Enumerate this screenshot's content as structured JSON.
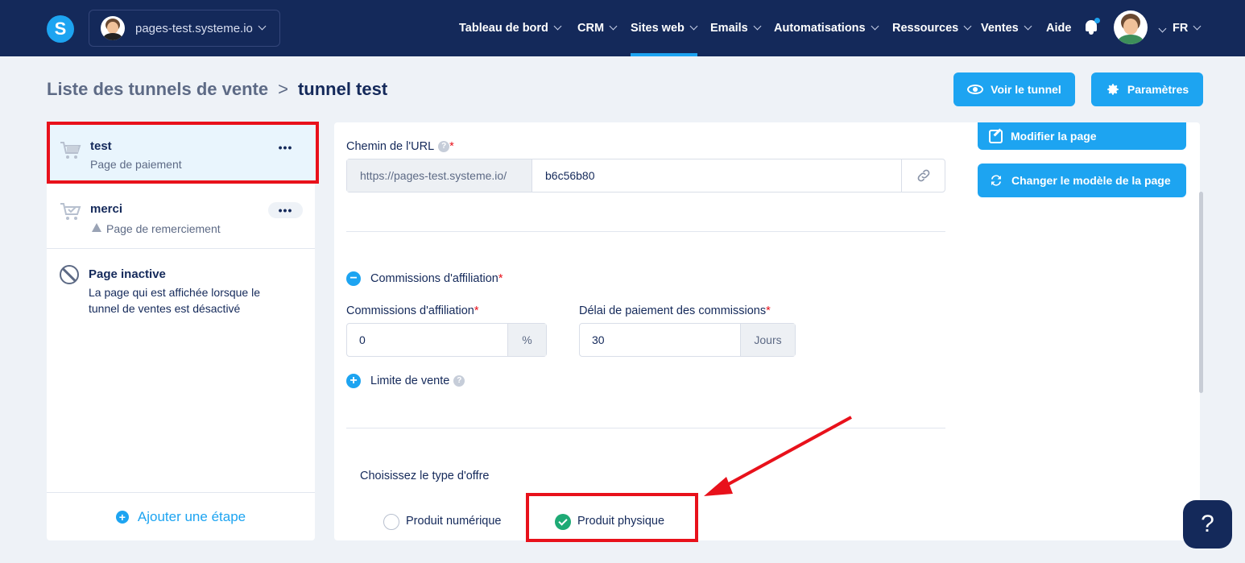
{
  "topbar": {
    "logo": "S",
    "site": "pages-test.systeme.io",
    "nav": [
      {
        "label": "Tableau de bord",
        "has_dropdown": true
      },
      {
        "label": "CRM",
        "has_dropdown": true
      },
      {
        "label": "Sites web",
        "has_dropdown": true,
        "active": true
      },
      {
        "label": "Emails",
        "has_dropdown": true
      },
      {
        "label": "Automatisations",
        "has_dropdown": true
      },
      {
        "label": "Ressources",
        "has_dropdown": true
      },
      {
        "label": "Ventes",
        "has_dropdown": true
      },
      {
        "label": "Aide",
        "has_dropdown": false
      }
    ],
    "lang": "FR"
  },
  "breadcrumb": {
    "parent": "Liste des tunnels de vente",
    "separator": ">",
    "current": "tunnel test"
  },
  "header_buttons": {
    "view": "Voir le tunnel",
    "settings": "Paramètres"
  },
  "sidebar": {
    "steps": [
      {
        "title": "test",
        "subtitle": "Page de paiement",
        "menu": "•••"
      },
      {
        "title": "merci",
        "subtitle": "Page de remerciement",
        "menu": "•••"
      }
    ],
    "inactive": {
      "title": "Page inactive",
      "description": "La page qui est affichée lorsque le tunnel de ventes est désactivé"
    },
    "add_step": "Ajouter une étape"
  },
  "main": {
    "url": {
      "label": "Chemin de l'URL",
      "required": "*",
      "help": "?",
      "prefix": "https://pages-test.systeme.io/",
      "value": "b6c56b80"
    },
    "affiliation_toggle": {
      "label": "Commissions d'affiliation",
      "required": "*",
      "icon": "−"
    },
    "commission": {
      "label": "Commissions d'affiliation",
      "required": "*",
      "value": "0",
      "suffix": "%"
    },
    "delay": {
      "label": "Délai de paiement des commissions",
      "required": "*",
      "value": "30",
      "suffix": "Jours"
    },
    "sale_limit": {
      "label": "Limite de vente",
      "help": "?",
      "icon": "+"
    },
    "offer_type": {
      "label": "Choisissez le type d'offre",
      "options": [
        {
          "label": "Produit numérique",
          "selected": false
        },
        {
          "label": "Produit physique",
          "selected": true
        }
      ]
    }
  },
  "side_actions": {
    "edit": "Modifier la page",
    "change_template": "Changer le modèle de la page"
  },
  "help_fab": "?",
  "colors": {
    "navy": "#14295a",
    "accent": "#1da4f1",
    "success": "#1eaa75",
    "highlight": "#e8111b",
    "background": "#eef2f7"
  }
}
